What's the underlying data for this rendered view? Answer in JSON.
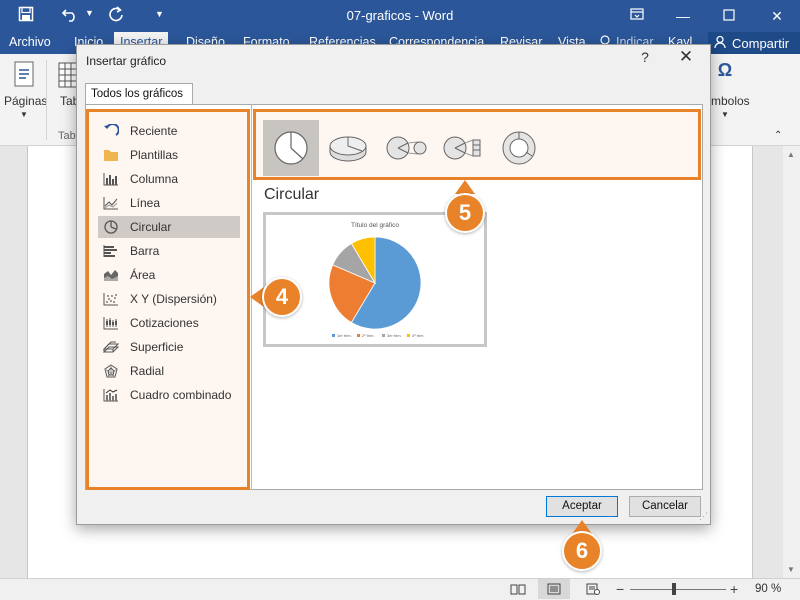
{
  "window": {
    "title": "07-graficos - Word",
    "quick_access": [
      "save-icon",
      "undo-icon",
      "redo-icon",
      "customize-icon"
    ],
    "controls": [
      "ribbon-display-icon",
      "minimize-icon",
      "maximize-icon",
      "close-icon"
    ]
  },
  "ribbon": {
    "tabs": [
      "Archivo",
      "Inicio",
      "Insertar",
      "Diseño",
      "Formato",
      "Referencias",
      "Correspondencia",
      "Revisar",
      "Vista"
    ],
    "active_tab": "Insertar",
    "tell_me": "Indicar",
    "user": "Kayl",
    "share": "Compartir",
    "groups": {
      "pages_label": "Páginas",
      "tables_label": "Tab",
      "tables_group": "Tab",
      "symbols_label": "mbolos"
    }
  },
  "dialog": {
    "title": "Insertar gráfico",
    "help": "?",
    "close": "✕",
    "tab": "Todos los gráficos",
    "categories": [
      {
        "label": "Reciente",
        "icon": "recent-icon"
      },
      {
        "label": "Plantillas",
        "icon": "folder-icon"
      },
      {
        "label": "Columna",
        "icon": "column-chart-icon"
      },
      {
        "label": "Línea",
        "icon": "line-chart-icon"
      },
      {
        "label": "Circular",
        "icon": "pie-chart-icon"
      },
      {
        "label": "Barra",
        "icon": "bar-chart-icon"
      },
      {
        "label": "Área",
        "icon": "area-chart-icon"
      },
      {
        "label": "X Y (Dispersión)",
        "icon": "scatter-chart-icon"
      },
      {
        "label": "Cotizaciones",
        "icon": "stock-chart-icon"
      },
      {
        "label": "Superficie",
        "icon": "surface-chart-icon"
      },
      {
        "label": "Radial",
        "icon": "radar-chart-icon"
      },
      {
        "label": "Cuadro combinado",
        "icon": "combo-chart-icon"
      }
    ],
    "selected_category": "Circular",
    "subtypes": [
      "pie-icon",
      "pie-3d-icon",
      "pie-of-pie-icon",
      "bar-of-pie-icon",
      "doughnut-icon"
    ],
    "chart_name": "Circular",
    "preview": {
      "title": "Título del gráfico",
      "legend": [
        "1er trim.",
        "2º trim.",
        "3er trim.",
        "4º trim."
      ],
      "colors": [
        "#5b9bd5",
        "#ed7d31",
        "#a5a5a5",
        "#ffc000"
      ]
    },
    "ok": "Aceptar",
    "cancel": "Cancelar"
  },
  "chart_data": {
    "type": "pie",
    "title": "Título del gráfico",
    "categories": [
      "1er trim.",
      "2º trim.",
      "3er trim.",
      "4º trim."
    ],
    "values": [
      8.2,
      3.2,
      1.4,
      1.2
    ]
  },
  "callouts": [
    "4",
    "5",
    "6"
  ],
  "status": {
    "zoom": "90 %"
  },
  "accent": "#e8832a"
}
